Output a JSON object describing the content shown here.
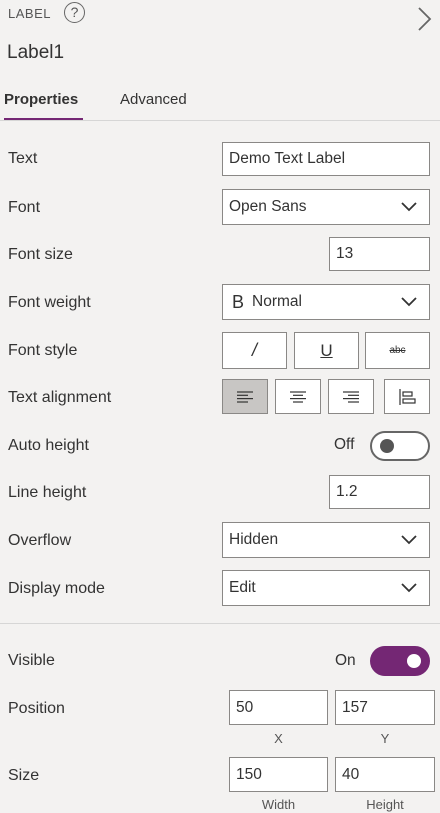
{
  "header": {
    "control_type": "LABEL",
    "help_glyph": "?",
    "control_name": "Label1"
  },
  "tabs": [
    {
      "label": "Properties",
      "active": true
    },
    {
      "label": "Advanced",
      "active": false
    }
  ],
  "properties": {
    "text": {
      "label": "Text",
      "value": "Demo Text Label"
    },
    "font": {
      "label": "Font",
      "value": "Open Sans"
    },
    "font_size": {
      "label": "Font size",
      "value": "13"
    },
    "font_weight": {
      "label": "Font weight",
      "glyph": "B",
      "value": "Normal"
    },
    "font_style": {
      "label": "Font style",
      "italic": "/",
      "underline": "U",
      "strike": "abc"
    },
    "text_alignment": {
      "label": "Text alignment",
      "selected": "left"
    },
    "auto_height": {
      "label": "Auto height",
      "state": "Off"
    },
    "line_height": {
      "label": "Line height",
      "value": "1.2"
    },
    "overflow": {
      "label": "Overflow",
      "value": "Hidden"
    },
    "display_mode": {
      "label": "Display mode",
      "value": "Edit"
    },
    "visible": {
      "label": "Visible",
      "state": "On"
    },
    "position": {
      "label": "Position",
      "x": "50",
      "y": "157",
      "x_label": "X",
      "y_label": "Y"
    },
    "size": {
      "label": "Size",
      "width": "150",
      "height": "40",
      "width_label": "Width",
      "height_label": "Height"
    }
  },
  "colors": {
    "accent": "#742774",
    "panel_bg": "#f3f2f1",
    "input_border": "#8a8886",
    "active_button": "#c8c6c4"
  },
  "icons": [
    "help-icon",
    "chevron-right-icon",
    "chevron-down-icon",
    "align-left-icon",
    "align-center-icon",
    "align-right-icon",
    "align-justify-icon"
  ]
}
